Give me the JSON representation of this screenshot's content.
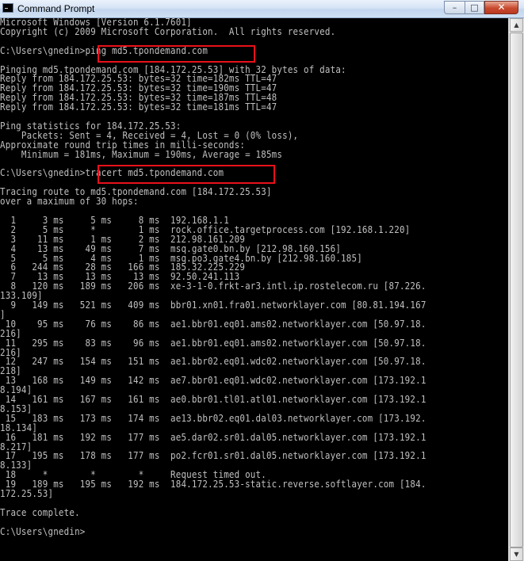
{
  "window": {
    "title": "Command Prompt",
    "icon": "cmd-icon"
  },
  "controls": {
    "minimize": "–",
    "maximize": "□",
    "close": "✕"
  },
  "scrollbar": {
    "up": "▲",
    "down": "▼"
  },
  "console": {
    "lines": [
      "Microsoft Windows [Version 6.1.7601]",
      "Copyright (c) 2009 Microsoft Corporation.  All rights reserved.",
      "",
      "C:\\Users\\gnedin>ping md5.tpondemand.com",
      "",
      "Pinging md5.tpondemand.com [184.172.25.53] with 32 bytes of data:",
      "Reply from 184.172.25.53: bytes=32 time=182ms TTL=47",
      "Reply from 184.172.25.53: bytes=32 time=190ms TTL=47",
      "Reply from 184.172.25.53: bytes=32 time=187ms TTL=48",
      "Reply from 184.172.25.53: bytes=32 time=181ms TTL=47",
      "",
      "Ping statistics for 184.172.25.53:",
      "    Packets: Sent = 4, Received = 4, Lost = 0 (0% loss),",
      "Approximate round trip times in milli-seconds:",
      "    Minimum = 181ms, Maximum = 190ms, Average = 185ms",
      "",
      "C:\\Users\\gnedin>tracert md5.tpondemand.com",
      "",
      "Tracing route to md5.tpondemand.com [184.172.25.53]",
      "over a maximum of 30 hops:",
      "",
      "  1     3 ms     5 ms     8 ms  192.168.1.1",
      "  2     5 ms     *        1 ms  rock.office.targetprocess.com [192.168.1.220]",
      "  3    11 ms     1 ms     2 ms  212.98.161.209",
      "  4    13 ms    49 ms     7 ms  msq.gate0.bn.by [212.98.160.156]",
      "  5     5 ms     4 ms     1 ms  msq.po3.gate4.bn.by [212.98.160.185]",
      "  6   244 ms    28 ms   166 ms  185.32.225.229",
      "  7    13 ms    13 ms    13 ms  92.50.241.113",
      "  8   120 ms   189 ms   206 ms  xe-3-1-0.frkt-ar3.intl.ip.rostelecom.ru [87.226.",
      "133.109]",
      "  9   149 ms   521 ms   409 ms  bbr01.xn01.fra01.networklayer.com [80.81.194.167",
      "]",
      " 10    95 ms    76 ms    86 ms  ae1.bbr01.eq01.ams02.networklayer.com [50.97.18.",
      "216]",
      " 11   295 ms    83 ms    96 ms  ae1.bbr01.eq01.ams02.networklayer.com [50.97.18.",
      "216]",
      " 12   247 ms   154 ms   151 ms  ae1.bbr02.eq01.wdc02.networklayer.com [50.97.18.",
      "218]",
      " 13   168 ms   149 ms   142 ms  ae7.bbr01.eq01.wdc02.networklayer.com [173.192.1",
      "8.194]",
      " 14   161 ms   167 ms   161 ms  ae0.bbr01.tl01.atl01.networklayer.com [173.192.1",
      "8.153]",
      " 15   183 ms   173 ms   174 ms  ae13.bbr02.eq01.dal03.networklayer.com [173.192.",
      "18.134]",
      " 16   181 ms   192 ms   177 ms  ae5.dar02.sr01.dal05.networklayer.com [173.192.1",
      "8.217]",
      " 17   195 ms   178 ms   177 ms  po2.fcr01.sr01.dal05.networklayer.com [173.192.1",
      "8.133]",
      " 18     *        *        *     Request timed out.",
      " 19   189 ms   195 ms   192 ms  184.172.25.53-static.reverse.softlayer.com [184.",
      "172.25.53]",
      "",
      "Trace complete.",
      "",
      "C:\\Users\\gnedin>"
    ]
  }
}
